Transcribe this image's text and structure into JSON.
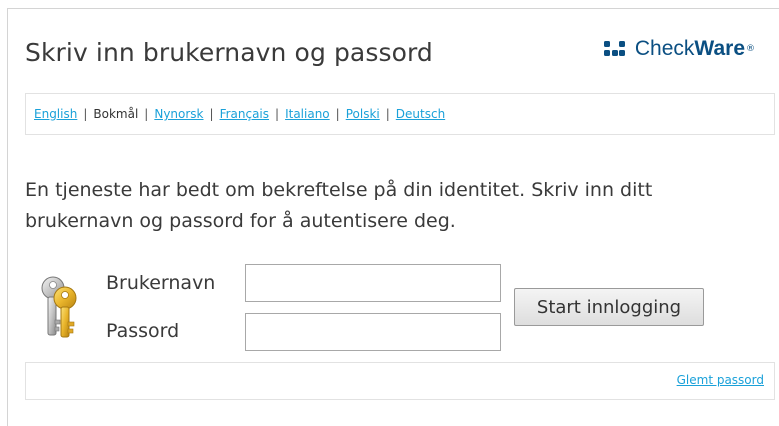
{
  "header": {
    "title": "Skriv inn brukernavn og passord",
    "logo": {
      "text_regular": "Check",
      "text_bold": "Ware",
      "trademark": "®",
      "color": "#0b4f82"
    }
  },
  "languages": {
    "items": [
      {
        "label": "English",
        "active": false
      },
      {
        "label": "Bokmål",
        "active": true
      },
      {
        "label": "Nynorsk",
        "active": false
      },
      {
        "label": "Français",
        "active": false
      },
      {
        "label": "Italiano",
        "active": false
      },
      {
        "label": "Polski",
        "active": false
      },
      {
        "label": "Deutsch",
        "active": false
      }
    ],
    "separator": "|",
    "link_color": "#1aa1d9"
  },
  "info": {
    "text": "En tjeneste har bedt om bekreftelse på din identitet. Skriv inn ditt brukernavn og passord for å autentisere deg."
  },
  "login": {
    "icon": "keys-icon",
    "username_label": "Brukernavn",
    "username_value": "",
    "password_label": "Passord",
    "password_value": "",
    "submit_label": "Start innlogging"
  },
  "footer": {
    "forgot_password_label": "Glemt passord"
  }
}
